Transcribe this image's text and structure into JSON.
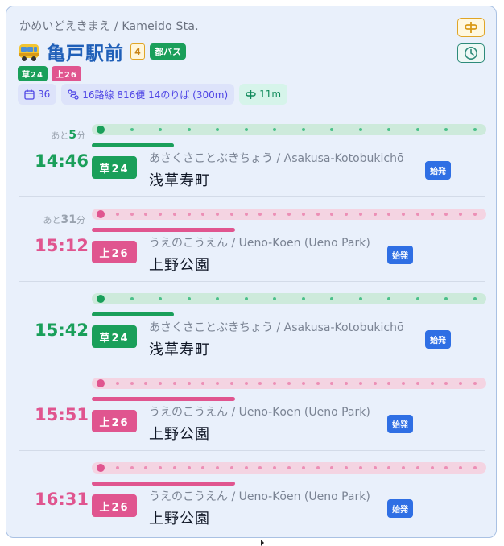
{
  "stop": {
    "reading": "かめいどえきまえ / Kameido Sta.",
    "name": "亀戸駅前",
    "platform_count": "4",
    "operator_badge": "都バス",
    "routes": [
      {
        "label": "草24",
        "color": "#1a9f5a"
      },
      {
        "label": "上26",
        "color": "#e0558f"
      }
    ],
    "info": {
      "calendar_count": "36",
      "summary": "16路線 816便 14のりば (300m)",
      "walk_time": "11m"
    }
  },
  "icons": {
    "bus": "bus-icon",
    "calendar": "calendar-icon",
    "route": "route-icon",
    "walk": "stop-sign-icon",
    "sign": "stop-sign-icon",
    "clock": "clock-icon"
  },
  "colors": {
    "green": "#1a9f5a",
    "pink": "#e0558f",
    "accent": "#1f5fb8",
    "start_badge": "#2f6fe4"
  },
  "departures": [
    {
      "remain_prefix": "あと",
      "remain_value": "5",
      "remain_unit": "分",
      "time": "14:46",
      "route": "草24",
      "color": "green",
      "kana": "あさくさことぶきちょう / Asakusa-Kotobukichō",
      "dest": "浅草寿町",
      "badge": "始発"
    },
    {
      "remain_prefix": "あと",
      "remain_value": "31",
      "remain_unit": "分",
      "time": "15:12",
      "route": "上26",
      "color": "pink",
      "kana": "うえのこうえん / Ueno-Kōen (Ueno Park)",
      "dest": "上野公園",
      "badge": "始発"
    },
    {
      "remain_prefix": "",
      "remain_value": "",
      "remain_unit": "",
      "time": "15:42",
      "route": "草24",
      "color": "green",
      "kana": "あさくさことぶきちょう / Asakusa-Kotobukichō",
      "dest": "浅草寿町",
      "badge": "始発"
    },
    {
      "remain_prefix": "",
      "remain_value": "",
      "remain_unit": "",
      "time": "15:51",
      "route": "上26",
      "color": "pink",
      "kana": "うえのこうえん / Ueno-Kōen (Ueno Park)",
      "dest": "上野公園",
      "badge": "始発"
    },
    {
      "remain_prefix": "",
      "remain_value": "",
      "remain_unit": "",
      "time": "16:31",
      "route": "上26",
      "color": "pink",
      "kana": "うえのこうえん / Ueno-Kōen (Ueno Park)",
      "dest": "上野公園",
      "badge": "始発"
    }
  ]
}
